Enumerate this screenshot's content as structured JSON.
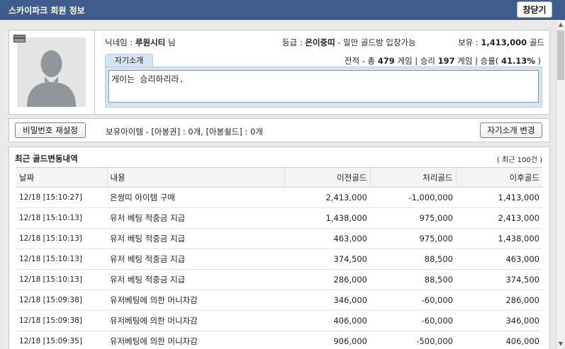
{
  "window": {
    "title": "스카이파크 회원 정보",
    "close_label": "창닫기"
  },
  "profile": {
    "nickname_label": "닉네임 :",
    "nickname": "루원시티",
    "nickname_suffix": "님",
    "grade_label": "등급 :",
    "grade": "은이중띠",
    "grade_desc": "- 일만 골드방 입장가능",
    "holding_label": "보유 :",
    "holding_amount": "1,413,000",
    "holding_unit": "골드",
    "intro_tab": "자기소개",
    "record_prefix": "전적 - 총",
    "total_games": "479",
    "games_unit": "게임 | 승리",
    "wins": "197",
    "wins_unit": "게임 | 승률(",
    "win_rate": "41.13%",
    "win_rate_close": ")",
    "intro_text": "게이는 승리하리라."
  },
  "actions": {
    "reset_password_label": "비밀번호 재설정",
    "items_text": "보유아이템 - [아봉권] : 0개, [아봉쉴드] : 0개",
    "edit_intro_label": "자기소개 변경"
  },
  "history": {
    "title": "최근 골드변동내역",
    "count_label": "( 최근 100건 )",
    "columns": [
      "날짜",
      "내용",
      "이전골드",
      "처리골드",
      "이후골드"
    ],
    "rows": [
      {
        "date": "12/18 [15:10:27]",
        "content": "은쌍띠 아이템 구매",
        "before": "2,413,000",
        "change": "-1,000,000",
        "after": "1,413,000"
      },
      {
        "date": "12/18 [15:10:13]",
        "content": "유저 베팅 적중금 지급",
        "before": "1,438,000",
        "change": "975,000",
        "after": "2,413,000"
      },
      {
        "date": "12/18 [15:10:13]",
        "content": "유저 베팅 적중금 지급",
        "before": "463,000",
        "change": "975,000",
        "after": "1,438,000"
      },
      {
        "date": "12/18 [15:10:13]",
        "content": "유저 베팅 적중금 지급",
        "before": "374,500",
        "change": "88,500",
        "after": "463,000"
      },
      {
        "date": "12/18 [15:10:13]",
        "content": "유저 베팅 적중금 지급",
        "before": "286,000",
        "change": "88,500",
        "after": "374,500"
      },
      {
        "date": "12/18 [15:09:38]",
        "content": "유저베팅에 의한 머니차감",
        "before": "346,000",
        "change": "-60,000",
        "after": "286,000"
      },
      {
        "date": "12/18 [15:09:38]",
        "content": "유저베팅에 의한 머니차감",
        "before": "406,000",
        "change": "-60,000",
        "after": "346,000"
      },
      {
        "date": "12/18 [15:09:35]",
        "content": "유저베팅에 의한 머니차감",
        "before": "906,000",
        "change": "-500,000",
        "after": "406,000"
      }
    ]
  },
  "icons": {
    "avatar": "default-user-silhouette",
    "card": "member-card-icon"
  },
  "colors": {
    "titlebar": "#3e5c8c",
    "tab_bg": "#d6e4f1"
  }
}
